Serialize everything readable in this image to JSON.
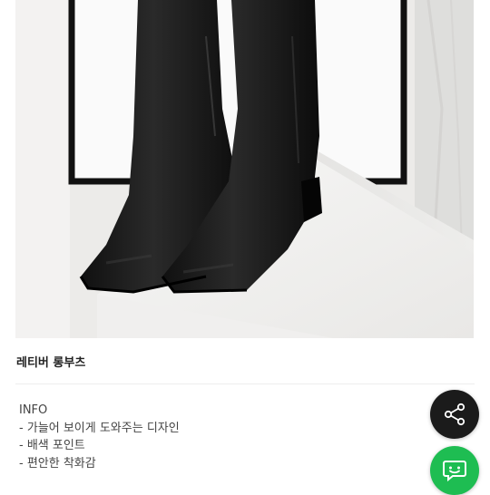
{
  "product": {
    "title": "레티버 롱부츠",
    "info_lines": [
      "INFO",
      "- 가늘어 보이게 도와주는 디자인",
      "- 배색 포인트",
      "- 편안한 착화감"
    ]
  },
  "image": {
    "subject": "black-leather-long-boots",
    "background": "white-frame-and-pedestal"
  },
  "actions": {
    "share_icon": "share-icon",
    "chat_icon": "chat-icon",
    "share_color": "#1b1b1b",
    "chat_color": "#1ebd52"
  }
}
